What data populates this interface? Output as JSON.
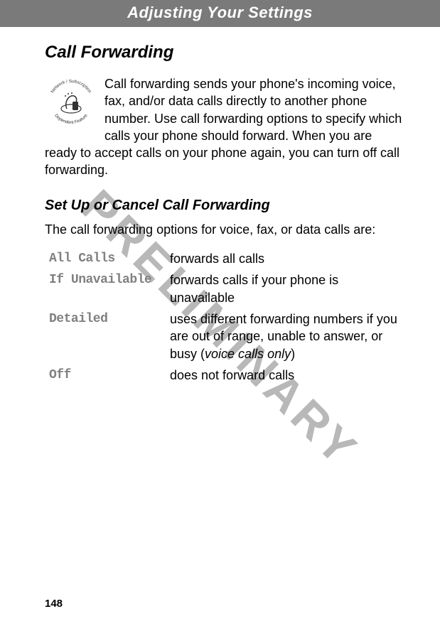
{
  "header": {
    "title": "Adjusting Your Settings"
  },
  "section": {
    "title": "Call Forwarding"
  },
  "badge": {
    "top_text": "Network / Subscription",
    "bottom_text": "Dependent Feature"
  },
  "intro": "Call forwarding sends your phone's incoming voice, fax, and/or data calls directly to another phone number. Use call forwarding options to specify which calls your phone should forward. When you are ready to accept calls on your phone again, you can turn off call forwarding.",
  "sub_section": {
    "title": "Set Up or Cancel Call Forwarding"
  },
  "sub_intro": "The call forwarding options for voice, fax, or data calls are:",
  "options": [
    {
      "label": "All Calls",
      "desc": "forwards all calls",
      "note": ""
    },
    {
      "label": "If Unavailable",
      "desc": "forwards calls if your phone is unavailable",
      "note": ""
    },
    {
      "label": "Detailed",
      "desc": "uses different forwarding numbers if you are out of range, unable to answer, or busy (",
      "note": "voice calls only",
      "after": ")"
    },
    {
      "label": "Off",
      "desc": "does not forward calls",
      "note": ""
    }
  ],
  "watermark": "PRELIMINARY",
  "page_number": "148"
}
